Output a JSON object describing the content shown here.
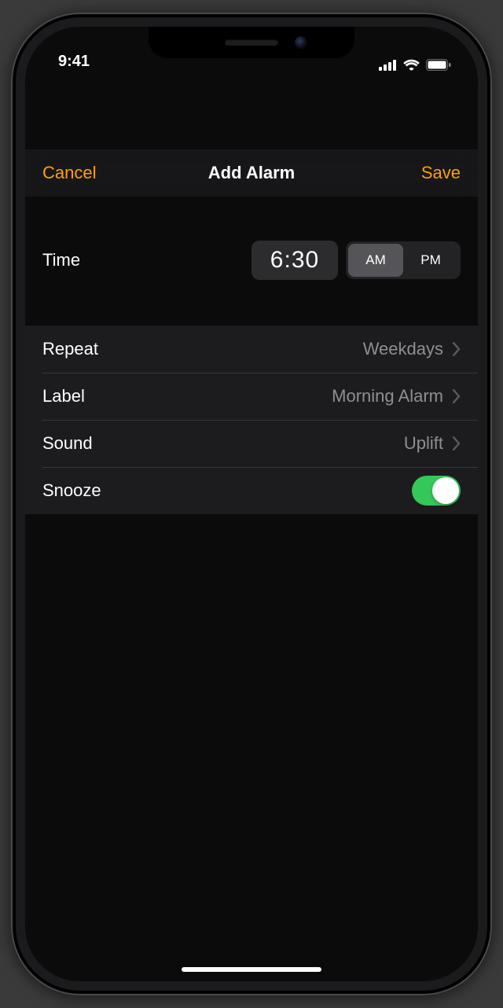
{
  "status": {
    "time": "9:41"
  },
  "nav": {
    "cancel": "Cancel",
    "title": "Add Alarm",
    "save": "Save"
  },
  "time_section": {
    "label": "Time",
    "value": "6:30",
    "am": "AM",
    "pm": "PM",
    "selected": "AM"
  },
  "rows": {
    "repeat": {
      "label": "Repeat",
      "value": "Weekdays"
    },
    "label": {
      "label": "Label",
      "value": "Morning Alarm"
    },
    "sound": {
      "label": "Sound",
      "value": "Uplift"
    },
    "snooze": {
      "label": "Snooze",
      "on": true
    }
  }
}
